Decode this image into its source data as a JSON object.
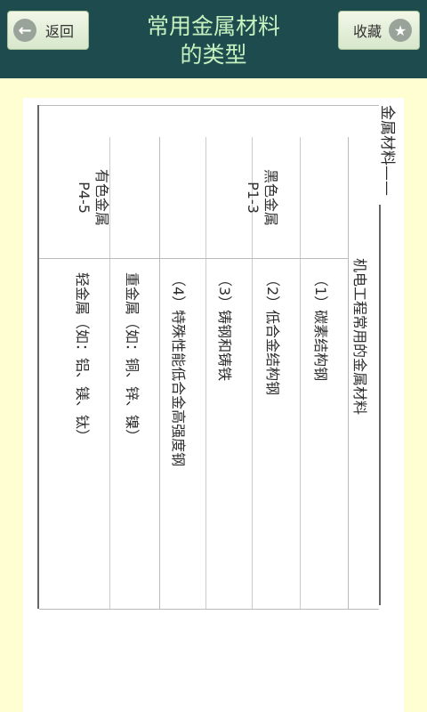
{
  "header": {
    "back_label": "返回",
    "back_icon": "arrow-left-icon",
    "title_line1": "常用金属材料",
    "title_line2": "的类型",
    "fav_label": "收藏",
    "fav_icon": "star-icon",
    "bar_color": "#1e4b4e",
    "title_color": "#c6f2c0"
  },
  "content": {
    "heading": "金属材料——",
    "table": {
      "main_label": "机电工程常用的金属材料",
      "ferrous_name": "黑色金属",
      "ferrous_pages": "P1-3",
      "nonferrous_name": "有色金属",
      "nonferrous_pages": "P4-5",
      "rows": [
        "（1）碳素结构钢",
        "（2）低合金结构钢",
        "（3）铸钢和铸铁",
        "（4）特殊性能低合金高强度钢",
        "重金属（如：铜、锌、镍）",
        "轻金属（如：铝、镁、钛）"
      ]
    }
  }
}
